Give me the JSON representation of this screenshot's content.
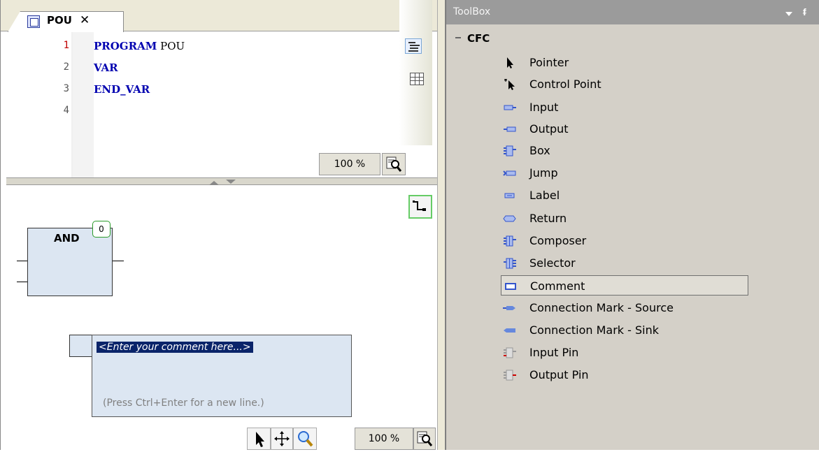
{
  "editor": {
    "tab_label": "POU",
    "tab_close": "✕",
    "line_numbers": [
      "1",
      "2",
      "3",
      "4"
    ],
    "code_lines": [
      {
        "keyword": "PROGRAM",
        "rest": " POU"
      },
      {
        "keyword": "VAR",
        "rest": ""
      },
      {
        "keyword": "END_VAR",
        "rest": ""
      }
    ],
    "zoom_top": "100 %",
    "zoom_bottom": "100 %"
  },
  "cfc": {
    "box_label": "AND",
    "execution_order": "0",
    "comment_text": "<Enter your comment here...>",
    "comment_hint": "(Press Ctrl+Enter for a new line.)"
  },
  "toolbox": {
    "title": "ToolBox",
    "pin_glyph": "ᵮ",
    "category": "CFC",
    "items": [
      {
        "label": "Pointer",
        "icon": "pointer-icon"
      },
      {
        "label": "Control Point",
        "icon": "control-point-icon"
      },
      {
        "label": "Input",
        "icon": "input-icon"
      },
      {
        "label": "Output",
        "icon": "output-icon"
      },
      {
        "label": "Box",
        "icon": "box-icon"
      },
      {
        "label": "Jump",
        "icon": "jump-icon"
      },
      {
        "label": "Label",
        "icon": "label-icon"
      },
      {
        "label": "Return",
        "icon": "return-icon"
      },
      {
        "label": "Composer",
        "icon": "composer-icon"
      },
      {
        "label": "Selector",
        "icon": "selector-icon"
      },
      {
        "label": "Comment",
        "icon": "comment-icon"
      },
      {
        "label": "Connection Mark - Source",
        "icon": "connection-mark-source-icon"
      },
      {
        "label": "Connection Mark - Sink",
        "icon": "connection-mark-sink-icon"
      },
      {
        "label": "Input Pin",
        "icon": "input-pin-icon"
      },
      {
        "label": "Output Pin",
        "icon": "output-pin-icon"
      }
    ],
    "selected_item": "Comment"
  },
  "colors": {
    "keyword": "#0000b0",
    "block_fill": "#dce6f2",
    "selection": "#0a246a",
    "toolbox_bg": "#d4d0c8",
    "toolbox_title": "#9b9b9b",
    "icon_blue": "#3355cc"
  }
}
